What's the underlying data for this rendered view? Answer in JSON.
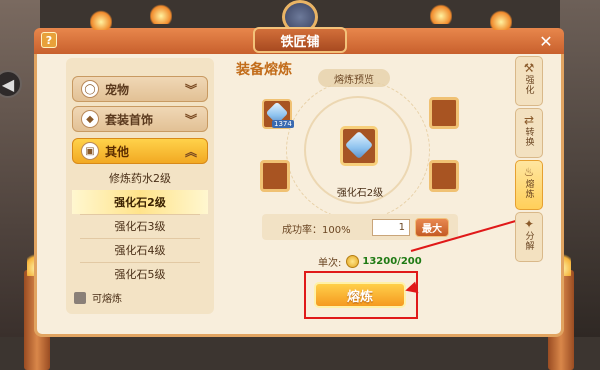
{
  "window": {
    "title": "铁匠铺",
    "help_label": "?",
    "close_label": "✕"
  },
  "sidebar": {
    "categories": [
      {
        "label": "宠物",
        "icon": "egg-icon"
      },
      {
        "label": "套装首饰",
        "icon": "tag-icon"
      },
      {
        "label": "其他",
        "icon": "bag-icon",
        "active": true
      }
    ],
    "sub_items": [
      {
        "label": "修炼药水2级"
      },
      {
        "label": "强化石2级",
        "selected": true
      },
      {
        "label": "强化石3级"
      },
      {
        "label": "强化石4级"
      },
      {
        "label": "强化石5级"
      }
    ],
    "filter_label": "可熔炼"
  },
  "main": {
    "title": "装备熔炼",
    "preview_label": "熔炼预览",
    "input_count": "1374",
    "result_name": "强化石2级",
    "success_label": "成功率：100%",
    "quantity": "1",
    "max_label": "最大",
    "cost_label": "单次:",
    "cost_value": "13200/200",
    "smelt_label": "熔炼"
  },
  "tabs": [
    {
      "label": "强化",
      "icon": "anvil-icon"
    },
    {
      "label": "转换",
      "icon": "convert-icon"
    },
    {
      "label": "熔炼",
      "icon": "flame-icon",
      "active": true
    },
    {
      "label": "分解",
      "icon": "decompose-icon"
    }
  ],
  "colors": {
    "accent": "#f59a20",
    "highlight": "#e01919",
    "cost_green": "#1f7a14"
  }
}
